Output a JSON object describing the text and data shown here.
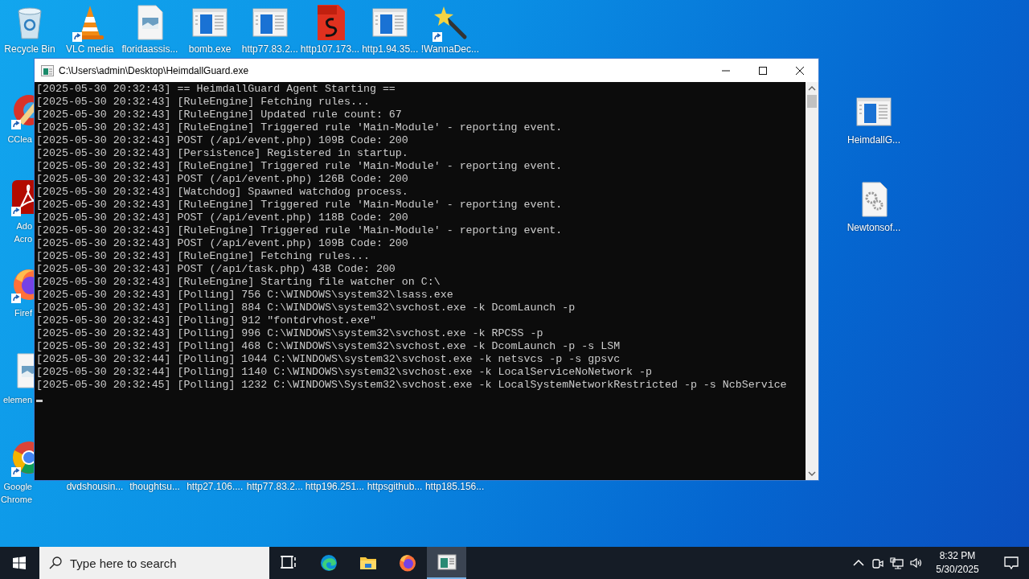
{
  "desktop": {
    "top_row": [
      {
        "label": "Recycle Bin",
        "kind": "recycle-bin",
        "shortcut": false
      },
      {
        "label": "VLC media",
        "kind": "vlc",
        "shortcut": true
      },
      {
        "label": "floridaassis...",
        "kind": "image-file",
        "shortcut": false
      },
      {
        "label": "bomb.exe",
        "kind": "app-window",
        "shortcut": false
      },
      {
        "label": "http77.83.2...",
        "kind": "app-window",
        "shortcut": false
      },
      {
        "label": "http107.173...",
        "kind": "pdf",
        "shortcut": false
      },
      {
        "label": "http1.94.35...",
        "kind": "app-window",
        "shortcut": false
      },
      {
        "label": "!WannaDec...",
        "kind": "wand",
        "shortcut": true
      }
    ],
    "left_column": [
      {
        "label": "CClea",
        "kind": "ccleaner",
        "shortcut": true
      },
      {
        "label": "Ado\nAcro",
        "kind": "acrobat",
        "shortcut": true
      },
      {
        "label": "Firef",
        "kind": "firefox",
        "shortcut": true
      },
      {
        "label": "elemen",
        "kind": "image-file",
        "shortcut": false
      },
      {
        "label": "Google\nChrome",
        "kind": "chrome",
        "shortcut": true
      }
    ],
    "bottom_row": [
      {
        "label": "dvdshousin..."
      },
      {
        "label": "thoughtsu..."
      },
      {
        "label": "http27.106...."
      },
      {
        "label": "http77.83.2..."
      },
      {
        "label": "http196.251..."
      },
      {
        "label": "httpsgithub..."
      },
      {
        "label": "http185.156..."
      }
    ],
    "right_column": [
      {
        "label": "HeimdallG...",
        "kind": "app-window",
        "shortcut": false
      },
      {
        "label": "Newtonsof...",
        "kind": "settings-file",
        "shortcut": false
      }
    ]
  },
  "window": {
    "title": "C:\\Users\\admin\\Desktop\\HeimdallGuard.exe",
    "console_lines": [
      "[2025-05-30 20:32:43] == HeimdallGuard Agent Starting ==",
      "[2025-05-30 20:32:43] [RuleEngine] Fetching rules...",
      "[2025-05-30 20:32:43] [RuleEngine] Updated rule count: 67",
      "[2025-05-30 20:32:43] [RuleEngine] Triggered rule 'Main-Module' - reporting event.",
      "[2025-05-30 20:32:43] POST (/api/event.php) 109B Code: 200",
      "[2025-05-30 20:32:43] [Persistence] Registered in startup.",
      "[2025-05-30 20:32:43] [RuleEngine] Triggered rule 'Main-Module' - reporting event.",
      "[2025-05-30 20:32:43] POST (/api/event.php) 126B Code: 200",
      "[2025-05-30 20:32:43] [Watchdog] Spawned watchdog process.",
      "[2025-05-30 20:32:43] [RuleEngine] Triggered rule 'Main-Module' - reporting event.",
      "[2025-05-30 20:32:43] POST (/api/event.php) 118B Code: 200",
      "[2025-05-30 20:32:43] [RuleEngine] Triggered rule 'Main-Module' - reporting event.",
      "[2025-05-30 20:32:43] POST (/api/event.php) 109B Code: 200",
      "[2025-05-30 20:32:43] [RuleEngine] Fetching rules...",
      "[2025-05-30 20:32:43] POST (/api/task.php) 43B Code: 200",
      "[2025-05-30 20:32:43] [RuleEngine] Starting file watcher on C:\\",
      "[2025-05-30 20:32:43] [Polling] 756 C:\\WINDOWS\\system32\\lsass.exe",
      "[2025-05-30 20:32:43] [Polling] 884 C:\\WINDOWS\\system32\\svchost.exe -k DcomLaunch -p",
      "[2025-05-30 20:32:43] [Polling] 912 \"fontdrvhost.exe\"",
      "[2025-05-30 20:32:43] [Polling] 996 C:\\WINDOWS\\system32\\svchost.exe -k RPCSS -p",
      "[2025-05-30 20:32:43] [Polling] 468 C:\\WINDOWS\\system32\\svchost.exe -k DcomLaunch -p -s LSM",
      "[2025-05-30 20:32:44] [Polling] 1044 C:\\WINDOWS\\system32\\svchost.exe -k netsvcs -p -s gpsvc",
      "[2025-05-30 20:32:44] [Polling] 1140 C:\\WINDOWS\\system32\\svchost.exe -k LocalServiceNoNetwork -p",
      "[2025-05-30 20:32:45] [Polling] 1232 C:\\WINDOWS\\System32\\svchost.exe -k LocalSystemNetworkRestricted -p -s NcbService"
    ]
  },
  "taskbar": {
    "search": {
      "placeholder": "Type here to search"
    },
    "apps": [
      {
        "kind": "task-view",
        "selected": false
      },
      {
        "kind": "edge",
        "selected": false
      },
      {
        "kind": "explorer",
        "selected": false
      },
      {
        "kind": "firefox",
        "selected": false
      },
      {
        "kind": "console",
        "selected": true
      }
    ],
    "clock": {
      "time": "8:32 PM",
      "date": "5/30/2025"
    }
  }
}
